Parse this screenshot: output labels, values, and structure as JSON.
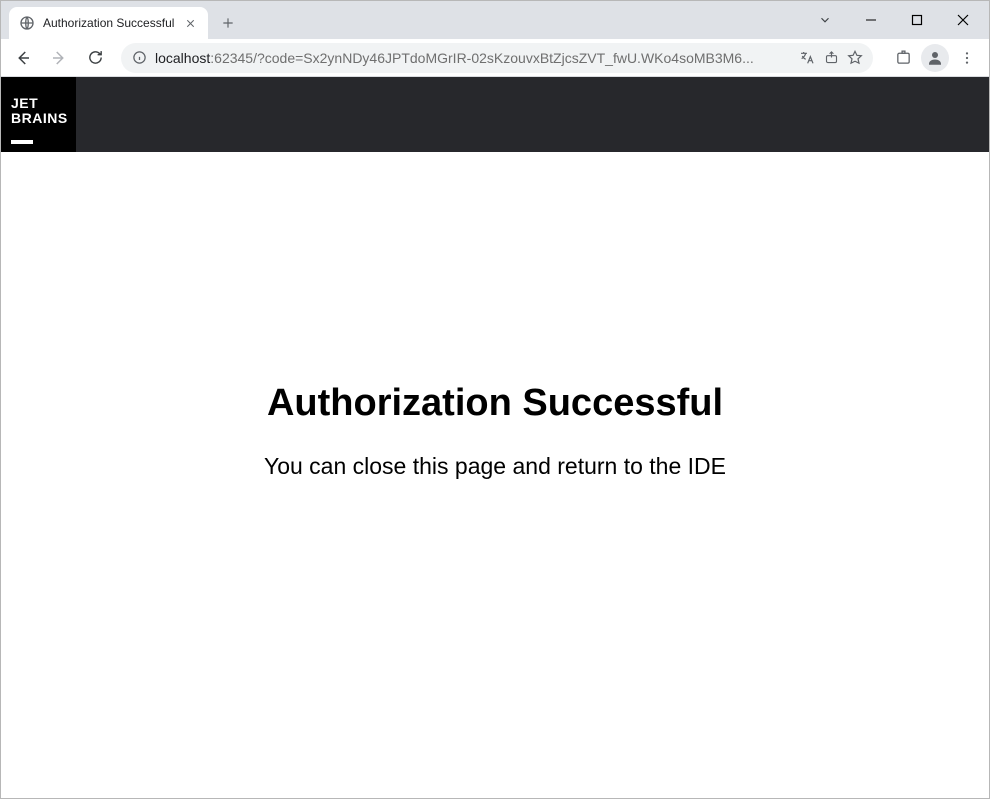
{
  "browser": {
    "tab": {
      "title": "Authorization Successful"
    },
    "url_host": "localhost",
    "url_port": ":62345",
    "url_path": "/?code=Sx2ynNDy46JPTdoMGrIR-02sKzouvxBtZjcsZVT_fwU.WKo4soMB3M6..."
  },
  "page": {
    "logo_line1": "JET",
    "logo_line2": "BRAINS",
    "heading": "Authorization Successful",
    "subtext": "You can close this page and return to the IDE"
  }
}
